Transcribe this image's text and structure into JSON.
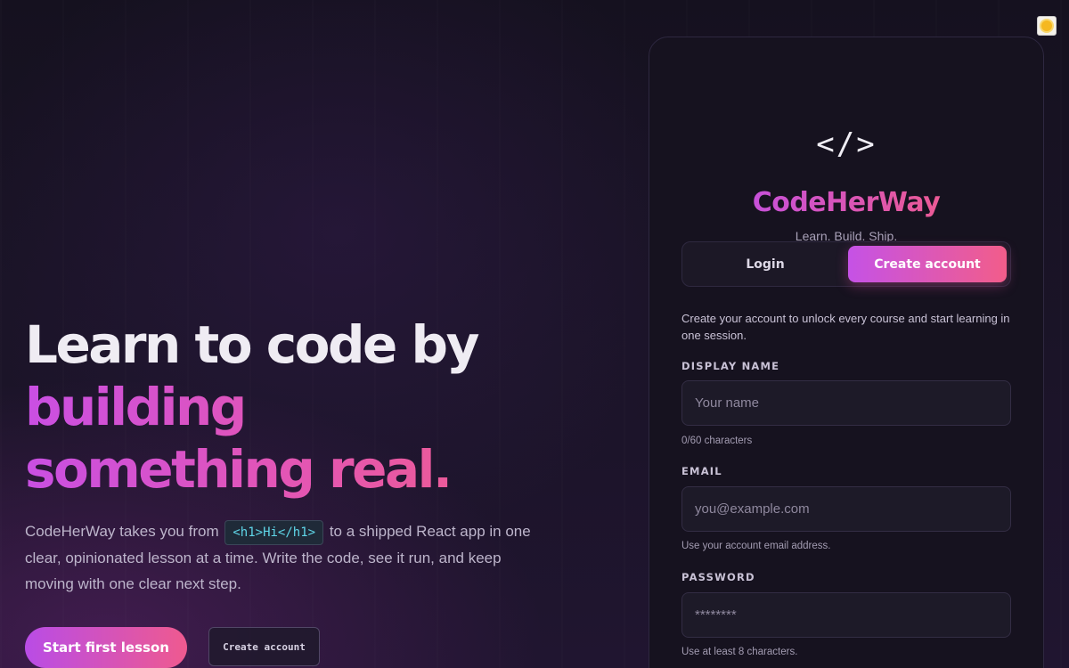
{
  "hero": {
    "title_line1": "Learn to code by",
    "title_line2": "building",
    "title_line3": "something real.",
    "desc_before": "CodeHerWay takes you from",
    "code_snippet": "<h1>Hi</h1>",
    "desc_after": "to a shipped React app in one clear, opinionated lesson at a time. Write the code, see it run, and keep moving with one clear next step.",
    "primary_cta": "Start first lesson",
    "secondary_cta": "Create account"
  },
  "theme_toggle": {
    "icon": "sun-icon"
  },
  "card": {
    "logo_glyph": "</>",
    "brand": "CodeHerWay",
    "tagline": "Learn. Build. Ship.",
    "tabs": [
      {
        "label": "Login",
        "active": false
      },
      {
        "label": "Create account",
        "active": true
      }
    ],
    "intro": "Create your account to unlock every course and start learning in one session.",
    "fields": {
      "display_name": {
        "label": "DISPLAY NAME",
        "placeholder": "Your name",
        "value": "",
        "hint": "0/60 characters"
      },
      "email": {
        "label": "EMAIL",
        "placeholder": "you@example.com",
        "value": "",
        "hint": "Use your account email address."
      },
      "password": {
        "label": "PASSWORD",
        "placeholder": "********",
        "value": "",
        "hint": "Use at least 8 characters."
      }
    }
  },
  "colors": {
    "background": "#15111f",
    "accent_purple": "#c24fe2",
    "accent_pink": "#f05b8c",
    "code_text": "#5fd6e8"
  }
}
